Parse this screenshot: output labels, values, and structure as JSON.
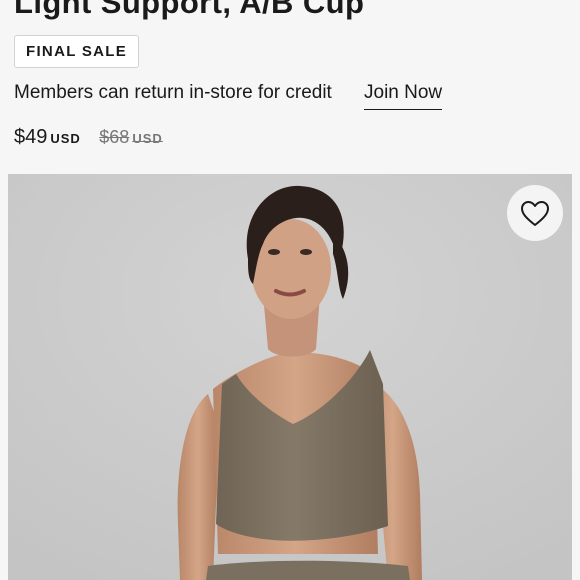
{
  "product": {
    "title": "Light Support, A/B Cup",
    "badge": "FINAL SALE",
    "member_note": "Members can return in-store for credit",
    "join_label": "Join Now",
    "price": "$49",
    "currency": "USD",
    "original_price": "$68",
    "original_currency": "USD"
  },
  "gallery": {
    "favorite_icon": "heart-outline-icon",
    "photo_subject": "model-wearing-olive-tank-top"
  },
  "colors": {
    "background": "#f6f6f6",
    "text": "#1a1a1a",
    "strikethrough": "#777777",
    "garment": "#7b6f60",
    "hair": "#2a1f1b"
  }
}
